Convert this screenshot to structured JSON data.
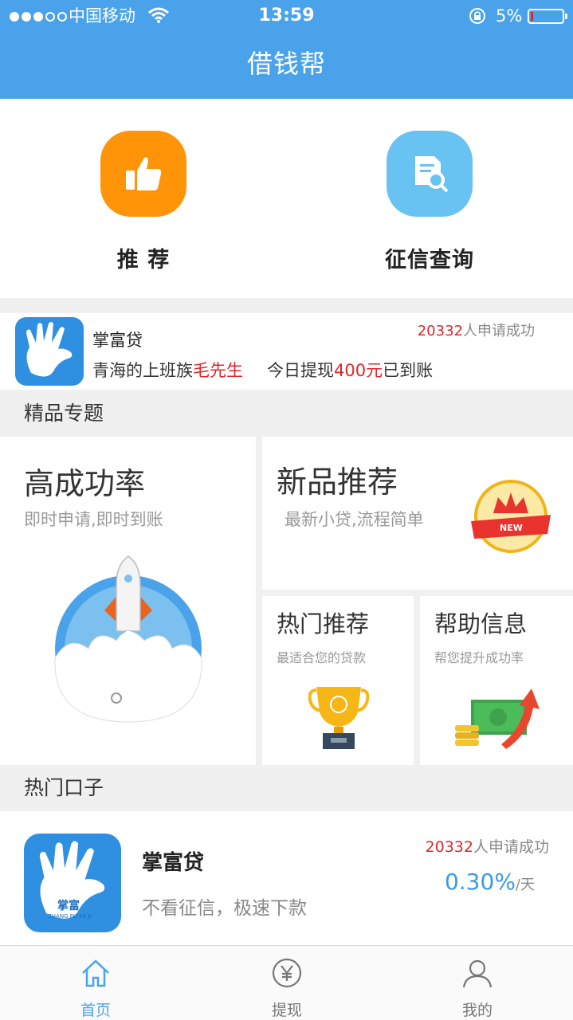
{
  "status_bar": {
    "carrier": "中国移动",
    "time": "13:59",
    "battery": "5%"
  },
  "app_title": "借钱帮",
  "quick_actions": [
    {
      "label": "推  荐",
      "icon": "thumbs-up-icon",
      "color": "#ff9408"
    },
    {
      "label": "征信查询",
      "icon": "document-search-icon",
      "color": "#69c3f2"
    }
  ],
  "ticker": {
    "product": "掌富贷",
    "count": "20332",
    "count_suffix": "人申请成功",
    "user_prefix": "青海的上班族",
    "user_name": "毛先生",
    "msg_prefix": "今日提现",
    "amount": "400元",
    "msg_suffix": "已到账"
  },
  "featured_section": {
    "title": "精品专题"
  },
  "featured": {
    "high_success": {
      "title": "高成功率",
      "subtitle": "即时申请,即时到账"
    },
    "new_products": {
      "title": "新品推荐",
      "subtitle": "最新小贷,流程简单",
      "badge": "NEW"
    },
    "hot_recommend": {
      "title": "热门推荐",
      "subtitle": "最适合您的贷款"
    },
    "help_info": {
      "title": "帮助信息",
      "subtitle": "帮您提升成功率"
    }
  },
  "hot_section": {
    "title": "热门口子"
  },
  "hot_product": {
    "name": "掌富贷",
    "desc": "不看征信，极速下款",
    "count": "20332",
    "count_suffix": "人申请成功",
    "rate": "0.30%",
    "rate_unit": "/天",
    "logo_text": "掌富",
    "logo_sub": "ZHANG FU KE JI"
  },
  "tabs": [
    {
      "label": "首页",
      "icon": "home-icon",
      "active": true
    },
    {
      "label": "提现",
      "icon": "yen-icon",
      "active": false
    },
    {
      "label": "我的",
      "icon": "user-icon",
      "active": false
    }
  ]
}
